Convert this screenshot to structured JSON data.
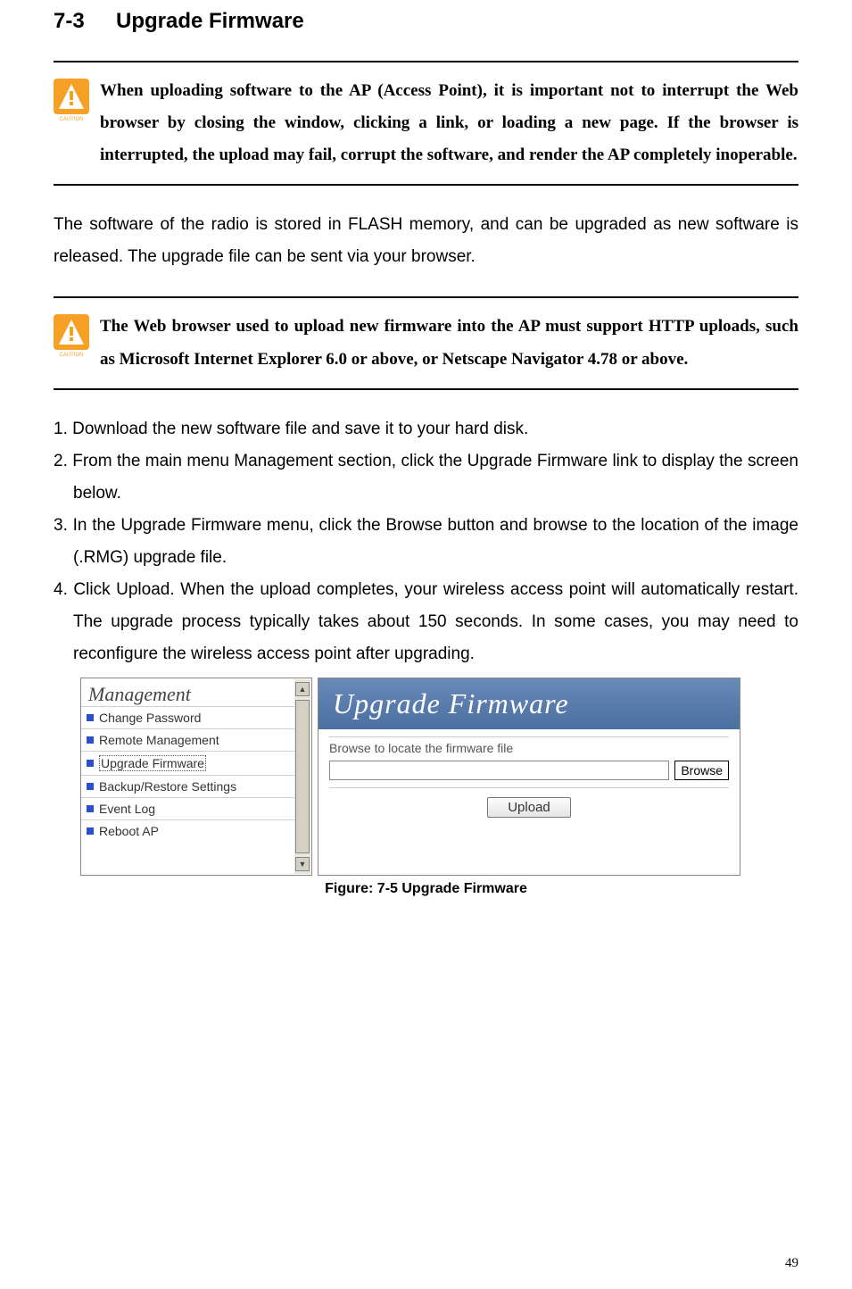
{
  "section": {
    "number": "7-3",
    "title": "Upgrade Firmware"
  },
  "caution1": {
    "text": "When uploading software to the AP (Access Point), it is important not to interrupt the Web browser by closing the window, clicking a link, or loading a new page. If the browser is interrupted, the upload may fail, corrupt the software, and render the AP completely inoperable."
  },
  "para1": "The software of the radio is stored in FLASH memory, and can be upgraded as new software is released. The upgrade file can be sent via your browser.",
  "caution2": {
    "text": "The Web browser used to upload new firmware into the AP must support HTTP uploads, such as Microsoft Internet Explorer 6.0 or above, or Netscape Navigator 4.78 or above."
  },
  "steps": {
    "s1": "1. Download the new software file and save it to your hard disk.",
    "s2": "2. From the main menu Management section, click the Upgrade Firmware link to display the screen below.",
    "s3": "3. In the Upgrade Firmware menu, click the Browse button and browse to the location of the image (.RMG) upgrade file.",
    "s4": "4. Click Upload. When the upload completes, your wireless access point will automatically restart. The upgrade process typically takes about 150 seconds. In some cases, you may need to reconfigure the wireless access point after upgrading."
  },
  "screenshot": {
    "mgmt_header": "Management",
    "items": [
      {
        "label": "Change Password"
      },
      {
        "label": "Remote Management"
      },
      {
        "label": "Upgrade Firmware"
      },
      {
        "label": "Backup/Restore Settings"
      },
      {
        "label": "Event Log"
      },
      {
        "label": "Reboot AP"
      }
    ],
    "right_title": "Upgrade Firmware",
    "browse_label": "Browse to locate the firmware file",
    "browse_button": "Browse",
    "upload_button": "Upload"
  },
  "figure_caption": "Figure: 7-5 Upgrade Firmware",
  "page_number": "49"
}
